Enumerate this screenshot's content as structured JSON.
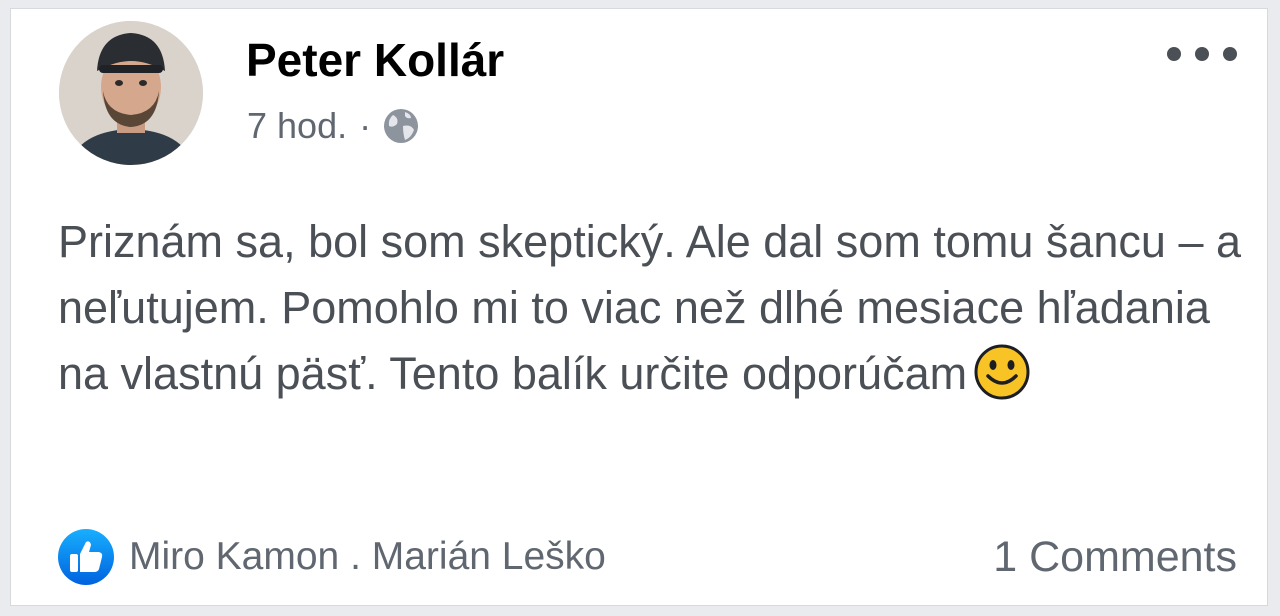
{
  "post": {
    "author": "Peter Kollár",
    "time": "7 hod.",
    "separator": "·",
    "visibility_icon": "globe-icon",
    "text": "Priznám sa, bol som skeptický. Ale dal som tomu šancu – a neľutujem. Pomohlo mi to viac než dlhé mesiace hľadania na vlastnú päsť. Tento balík určite odporúčam",
    "emoji": "slightly-smiling-face"
  },
  "reactions": {
    "icon": "like-icon",
    "names": "Miro Kamon . Marián Leško"
  },
  "comments": {
    "label": "1 Comments"
  },
  "colors": {
    "like_blue": "#1877f2",
    "text_gray": "#4b4f56",
    "meta_gray": "#606770",
    "emoji_yellow": "#f7c325"
  }
}
